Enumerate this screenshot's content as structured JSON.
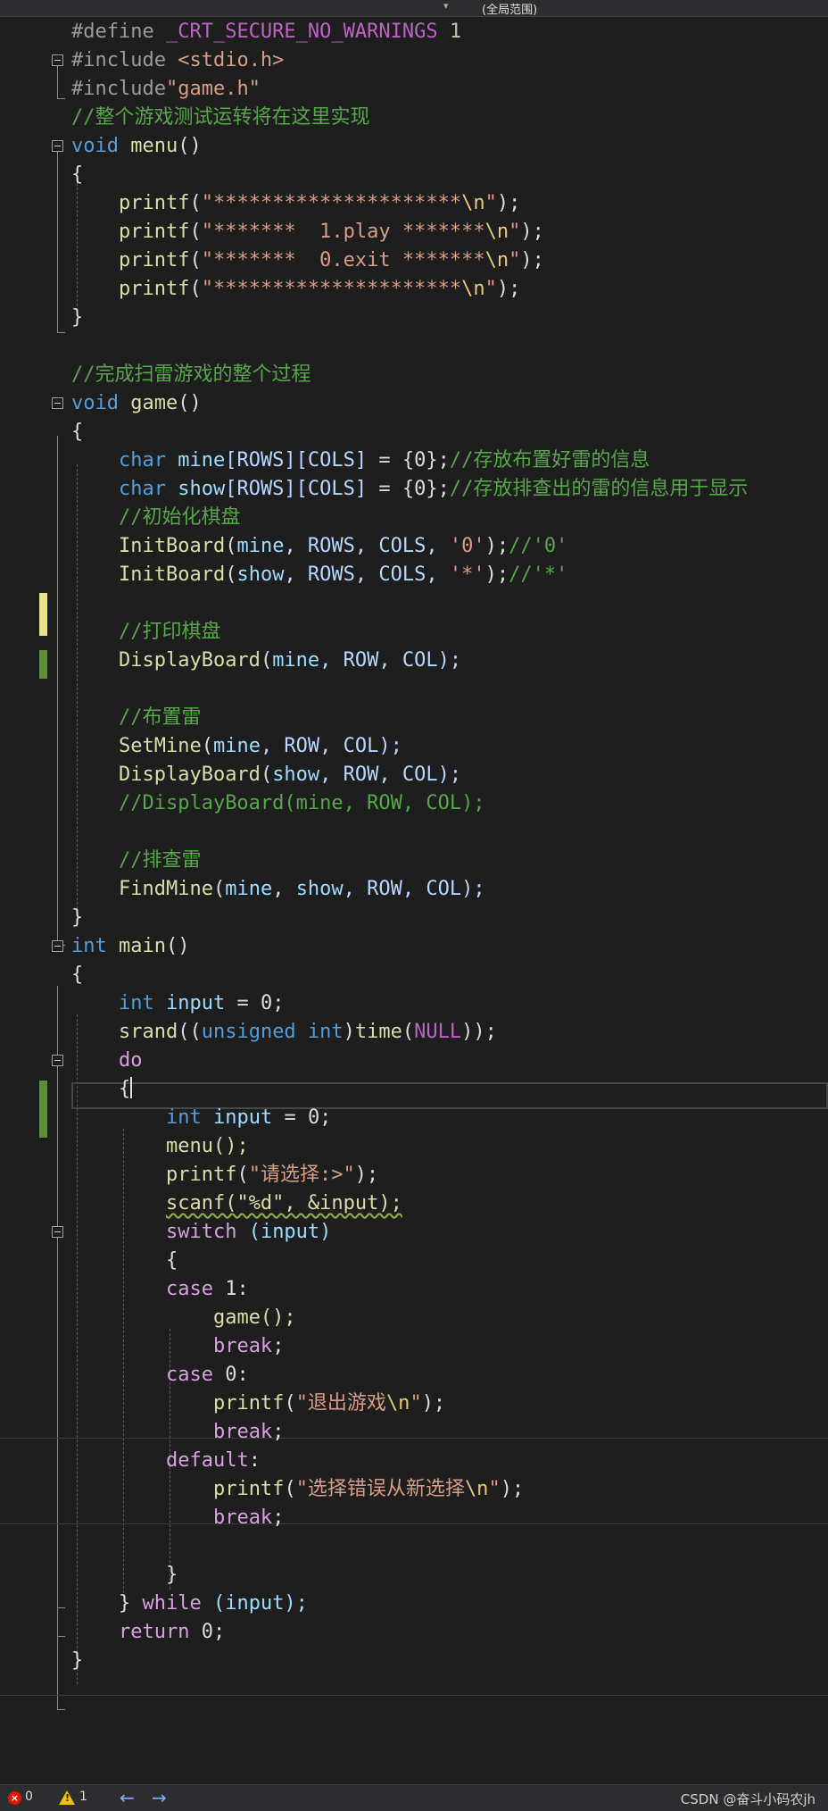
{
  "toolbar": {
    "scope_label": "(全局范围)",
    "dropdown_arrow": "▾"
  },
  "code": {
    "l1": "#define",
    "l1_name": "_CRT_SECURE_NO_WARNINGS",
    "l1_val": "1",
    "l2_directive": "#include",
    "l2_header": "<stdio.h>",
    "l3_directive": "#include",
    "l3_header": "\"game.h\"",
    "l4": "//整个游戏测试运转将在这里实现",
    "l5_kw": "void",
    "l5_fn": "menu",
    "l5_rest": "()",
    "brace_open": "{",
    "brace_close": "}",
    "printf": "printf",
    "l7_str": "\"*********************",
    "l8_str": "\"*******  1.play *******",
    "l9_str": "\"*******  0.exit *******",
    "l10_str": "\"*********************",
    "esc_n": "\\n",
    "quote_end": "\"",
    "close_semi": ");",
    "l13": "//完成扫雷游戏的整个过程",
    "l14_kw": "void",
    "l14_fn": "game",
    "l14_rest": "()",
    "kw_char": "char",
    "mine": "mine",
    "show": "show",
    "dims": "[ROWS][COLS]",
    "init_zero": " = {0};",
    "c16_cmt": "//存放布置好雷的信息",
    "c17_cmt": "//存放排查出的雷的信息用于显示",
    "l18": "//初始化棋盘",
    "initboard": "InitBoard",
    "args_rows": ", ROWS, COLS, ",
    "char_0": "'0'",
    "char_star": "'*'",
    "l19_cmt": "//'0'",
    "l20_cmt": "//'*'",
    "l22": "//打印棋盘",
    "displayboard": "DisplayBoard",
    "args_row": ", ROW, COL);",
    "l25": "//布置雷",
    "setmine": "SetMine",
    "l28": "//DisplayBoard(mine, ROW, COL);",
    "l30": "//排查雷",
    "findmine": "FindMine",
    "l31_args": ", ROW, COL);",
    "kw_int": "int",
    "main_fn": "main",
    "main_rest": "()",
    "input": "input",
    "assign_zero": " = 0;",
    "srand": "srand",
    "srand_kw": "unsigned int",
    "time_fn": "time",
    "null_const": "NULL",
    "kw_do": "do",
    "menu_call": "menu();",
    "l39_str": "\"请选择:>\"",
    "scanf_call": "scanf(\"%d\", &input);",
    "kw_switch": "switch",
    "switch_cond": " (input)",
    "kw_case": "case",
    "case1": " 1:",
    "case0": " 0:",
    "game_call": "game();",
    "kw_break": "break",
    "semi": ";",
    "l47_str": "\"退出游戏",
    "kw_default": "default",
    "colon": ":",
    "l50_str": "\"选择错误从新选择",
    "kw_while": "while",
    "while_cond": " (input);",
    "kw_return": "return",
    "return_val": " 0;"
  },
  "status": {
    "errors": "0",
    "warnings": "1",
    "nav_back": "←",
    "nav_forward": "→",
    "watermark": "CSDN @奋斗小码农jh"
  }
}
